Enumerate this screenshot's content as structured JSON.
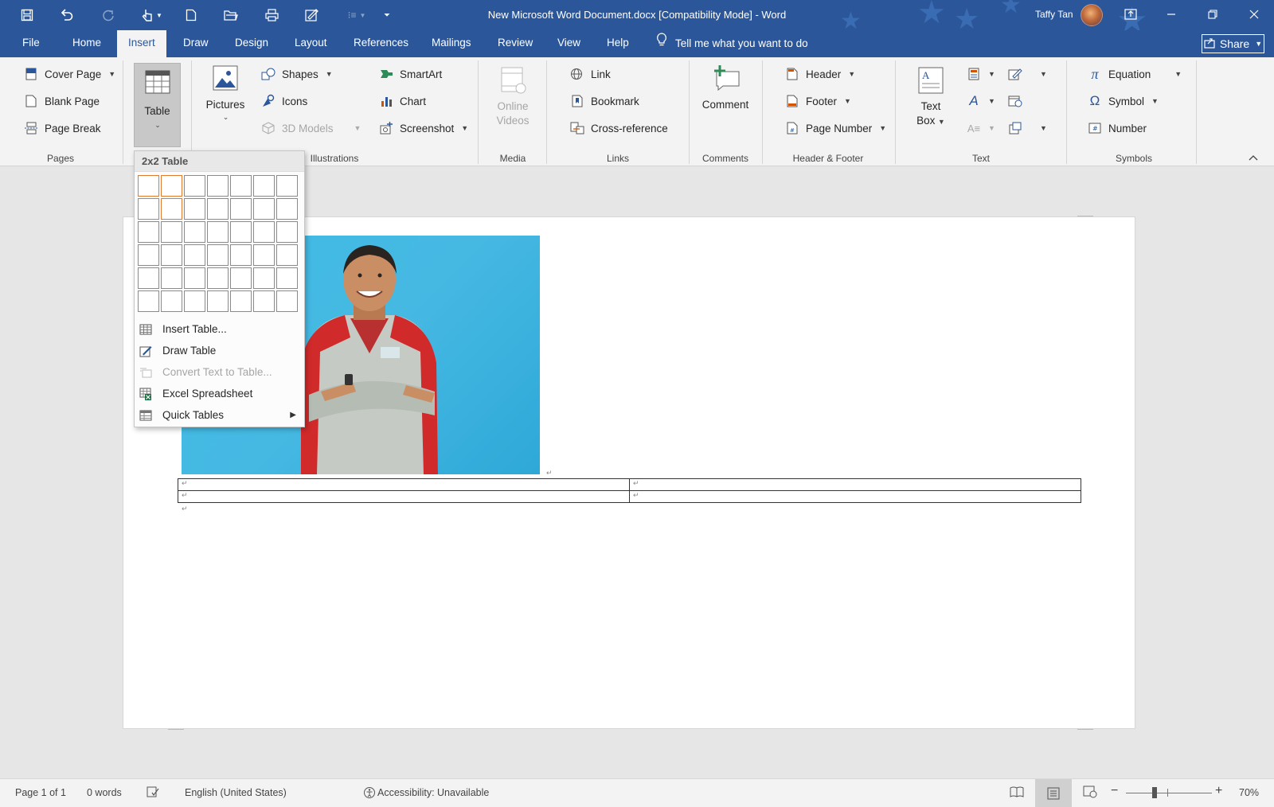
{
  "window": {
    "title": "New Microsoft Word Document.docx  [Compatibility Mode]  -  Word",
    "user": "Taffy Tan"
  },
  "tabs": [
    "File",
    "Home",
    "Insert",
    "Draw",
    "Design",
    "Layout",
    "References",
    "Mailings",
    "Review",
    "View",
    "Help"
  ],
  "active_tab": "Insert",
  "tell_me": "Tell me what you want to do",
  "share_label": "Share",
  "ribbon": {
    "pages": {
      "label": "Pages",
      "cover_page": "Cover Page",
      "blank_page": "Blank Page",
      "page_break": "Page Break"
    },
    "tables": {
      "table": "Table"
    },
    "illustrations": {
      "label": "Illustrations",
      "pictures": "Pictures",
      "shapes": "Shapes",
      "icons": "Icons",
      "models_3d": "3D Models",
      "smartart": "SmartArt",
      "chart": "Chart",
      "screenshot": "Screenshot"
    },
    "media": {
      "label": "Media",
      "online_videos_1": "Online",
      "online_videos_2": "Videos"
    },
    "links": {
      "label": "Links",
      "link": "Link",
      "bookmark": "Bookmark",
      "cross_reference": "Cross-reference"
    },
    "comments": {
      "label": "Comments",
      "comment": "Comment"
    },
    "header_footer": {
      "label": "Header & Footer",
      "header": "Header",
      "footer": "Footer",
      "page_number": "Page Number"
    },
    "text": {
      "label": "Text",
      "text_box_1": "Text",
      "text_box_2": "Box"
    },
    "symbols": {
      "label": "Symbols",
      "equation": "Equation",
      "symbol": "Symbol",
      "number": "Number"
    }
  },
  "table_menu": {
    "header": "2x2 Table",
    "grid_cols": 7,
    "grid_rows": 6,
    "selected_cols": 2,
    "selected_rows": 2,
    "items": [
      {
        "label": "Insert Table...",
        "enabled": true,
        "submenu": false
      },
      {
        "label": "Draw Table",
        "enabled": true,
        "submenu": false
      },
      {
        "label": "Convert Text to Table...",
        "enabled": false,
        "submenu": false
      },
      {
        "label": "Excel Spreadsheet",
        "enabled": true,
        "submenu": false
      },
      {
        "label": "Quick Tables",
        "enabled": true,
        "submenu": true
      }
    ]
  },
  "document": {
    "paragraph_mark": "↵",
    "table_rows": 2,
    "table_cols": 2
  },
  "status": {
    "page": "Page 1 of 1",
    "words": "0 words",
    "language": "English (United States)",
    "accessibility": "Accessibility: Unavailable",
    "zoom": "70%"
  },
  "colors": {
    "brand": "#2b579a",
    "selection": "#e07a32"
  }
}
